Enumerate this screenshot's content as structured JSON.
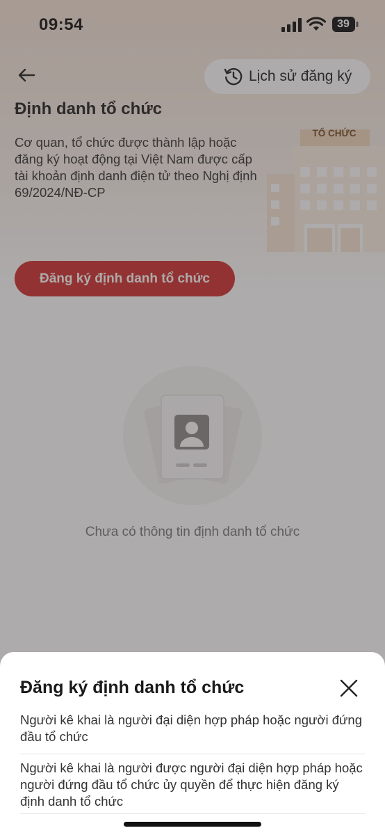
{
  "status_bar": {
    "time": "09:54",
    "battery": "39"
  },
  "header": {
    "history_button_label": "Lịch sử đăng ký"
  },
  "page": {
    "title": "Định danh tổ chức",
    "description": "Cơ quan, tổ chức được thành lập hoặc đăng ký hoạt động tại Việt Nam được cấp tài khoản định danh điện tử theo Nghị định 69/2024/NĐ-CP",
    "illustration_label": "TỔ CHỨC",
    "register_button_label": "Đăng ký định danh tổ chức",
    "empty_state_text": "Chưa có thông tin định danh tổ chức"
  },
  "bottom_sheet": {
    "title": "Đăng ký định danh tổ chức",
    "options": [
      {
        "label": "Người kê khai là người đại diện hợp pháp hoặc người đứng đầu tổ chức"
      },
      {
        "label": "Người kê khai là người được người đại diện hợp pháp hoặc người đứng đầu tổ chức ủy quyền để thực hiện đăng ký định danh tổ chức"
      }
    ]
  },
  "colors": {
    "accent": "#d32f2f",
    "overlay": "#3c3737"
  },
  "icons": {
    "back": "arrow-left-icon",
    "history": "history-clock-icon",
    "close": "close-icon",
    "signal": "signal-icon",
    "wifi": "wifi-icon",
    "battery": "battery-icon",
    "empty_state": "id-card-icon"
  }
}
